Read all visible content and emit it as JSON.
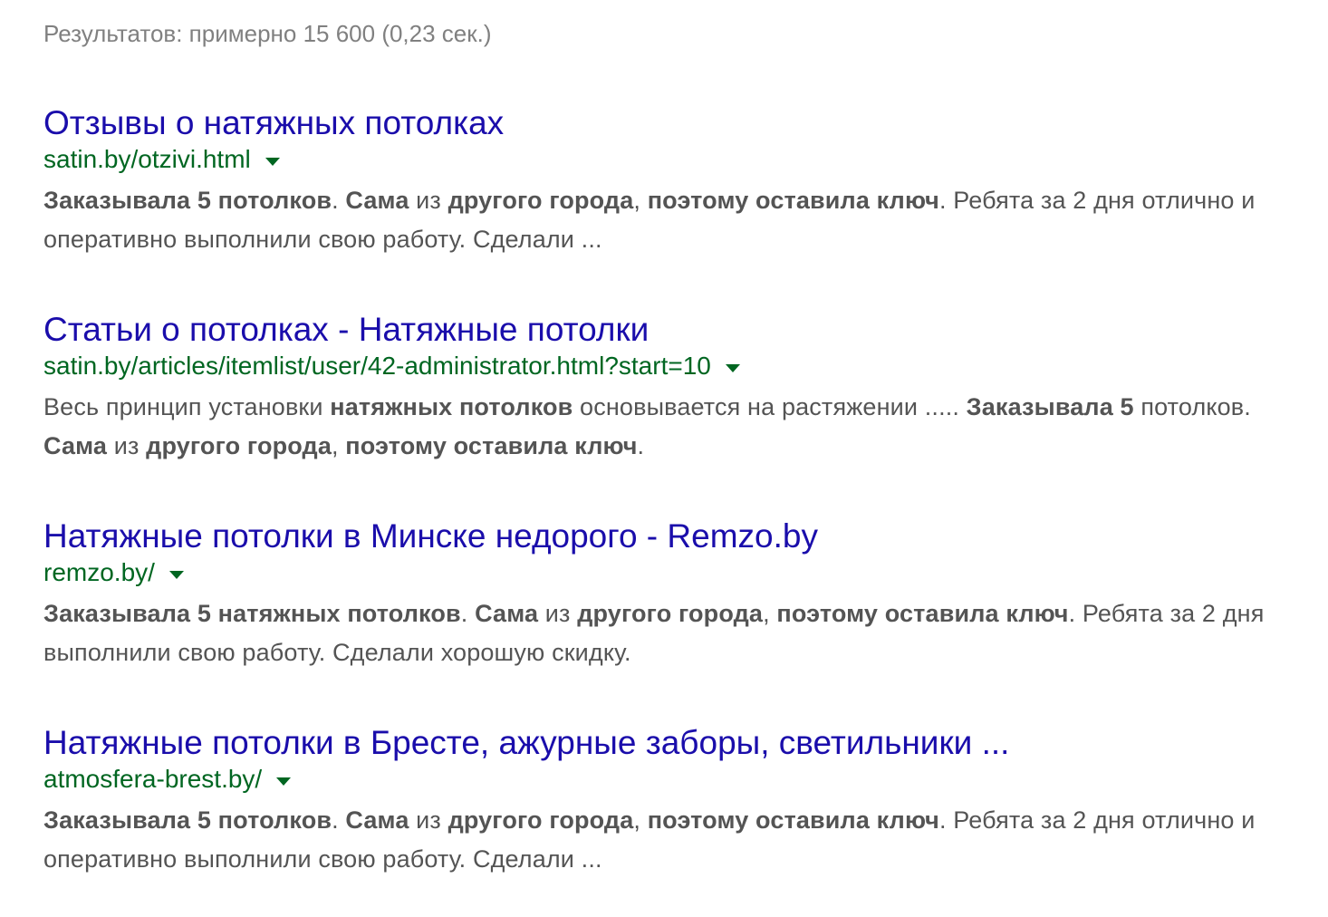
{
  "stats": "Результатов: примерно 15 600 (0,23 сек.)",
  "colors": {
    "title": "#1a0dab",
    "url": "#006621",
    "snippet": "#545454",
    "stats": "#808080"
  },
  "icons": {
    "dropdown": "triangle-down"
  },
  "results": [
    {
      "title": "Отзывы о натяжных потолках",
      "url": "satin.by/otzivi.html",
      "snippet": [
        {
          "t": "Заказывала 5 потолков",
          "b": true
        },
        {
          "t": ". ",
          "b": false
        },
        {
          "t": "Сама",
          "b": true
        },
        {
          "t": " из ",
          "b": false
        },
        {
          "t": "другого города",
          "b": true
        },
        {
          "t": ", ",
          "b": false
        },
        {
          "t": "поэтому оставила ключ",
          "b": true
        },
        {
          "t": ". Ребята за 2 дня отлично и оперативно выполнили свою работу. Сделали ...",
          "b": false
        }
      ]
    },
    {
      "title": "Статьи о потолках - Натяжные потолки",
      "url": "satin.by/articles/itemlist/user/42-administrator.html?start=10",
      "snippet": [
        {
          "t": "Весь принцип установки ",
          "b": false
        },
        {
          "t": "натяжных потолков",
          "b": true
        },
        {
          "t": " основывается на растяжении ..... ",
          "b": false
        },
        {
          "t": "Заказывала 5",
          "b": true
        },
        {
          "t": " потолков. ",
          "b": false
        },
        {
          "t": "Сама",
          "b": true
        },
        {
          "t": " из ",
          "b": false
        },
        {
          "t": "другого города",
          "b": true
        },
        {
          "t": ", ",
          "b": false
        },
        {
          "t": "поэтому оставила ключ",
          "b": true
        },
        {
          "t": ".",
          "b": false
        }
      ]
    },
    {
      "title": "Натяжные потолки в Минске недорого - Remzo.by",
      "url": "remzo.by/",
      "snippet": [
        {
          "t": "Заказывала 5 натяжных потолков",
          "b": true
        },
        {
          "t": ". ",
          "b": false
        },
        {
          "t": "Сама",
          "b": true
        },
        {
          "t": " из ",
          "b": false
        },
        {
          "t": "другого города",
          "b": true
        },
        {
          "t": ", ",
          "b": false
        },
        {
          "t": "поэтому оставила ключ",
          "b": true
        },
        {
          "t": ". Ребята за 2 дня выполнили свою работу. Сделали хорошую скидку.",
          "b": false
        }
      ]
    },
    {
      "title": "Натяжные потолки в Бресте, ажурные заборы, светильники ...",
      "url": "atmosfera-brest.by/",
      "snippet": [
        {
          "t": "Заказывала 5 потолков",
          "b": true
        },
        {
          "t": ". ",
          "b": false
        },
        {
          "t": "Сама",
          "b": true
        },
        {
          "t": " из ",
          "b": false
        },
        {
          "t": "другого города",
          "b": true
        },
        {
          "t": ", ",
          "b": false
        },
        {
          "t": "поэтому оставила ключ",
          "b": true
        },
        {
          "t": ". Ребята за 2 дня отлично и оперативно выполнили свою работу. Сделали ...",
          "b": false
        }
      ]
    }
  ]
}
